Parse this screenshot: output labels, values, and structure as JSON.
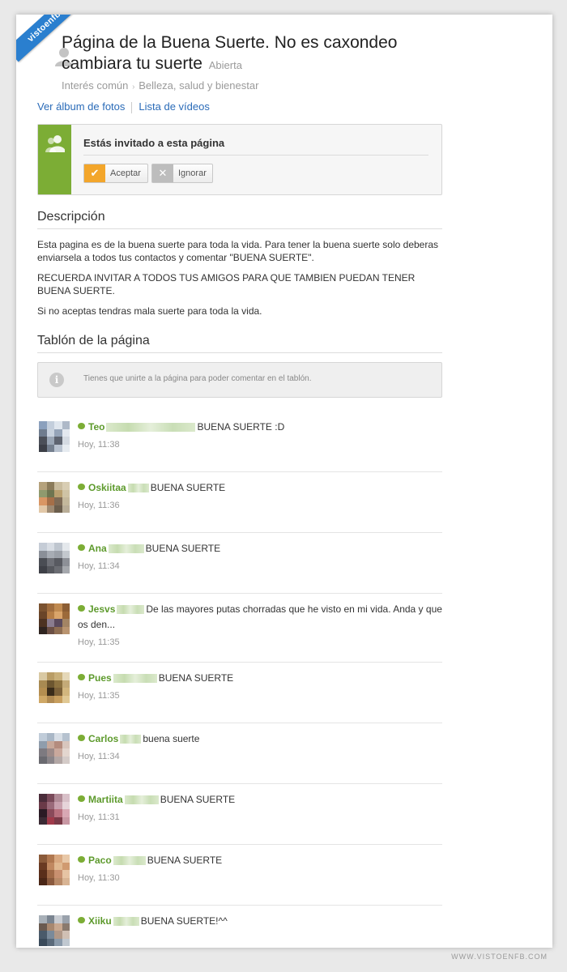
{
  "ribbon": "vistoenfb.com",
  "page": {
    "title": "Página de la Buena Suerte. No es caxondeo cambiara tu suerte",
    "status": "Abierta",
    "breadcrumb": [
      "Interés común",
      "Belleza, salud y bienestar"
    ]
  },
  "links": {
    "photos": "Ver álbum de fotos",
    "videos": "Lista de vídeos"
  },
  "invite": {
    "title": "Estás invitado a esta página",
    "accept_label": "Aceptar",
    "ignore_label": "Ignorar",
    "accent_color": "#7cad35"
  },
  "description": {
    "heading": "Descripción",
    "paragraphs": [
      "Esta pagina es de la buena suerte para toda la vida. Para tener la buena suerte solo deberas enviarsela a todos tus contactos y comentar \"BUENA SUERTE\".",
      "RECUERDA INVITAR A TODOS TUS AMIGOS PARA QUE TAMBIEN PUEDAN TENER BUENA SUERTE.",
      "Si no aceptas tendras mala suerte para toda la vida."
    ]
  },
  "wall": {
    "heading": "Tablón de la página",
    "notice": "Tienes que unirte a la página para poder comentar en el tablón.",
    "comments": [
      {
        "author": "Teo",
        "text": "BUENA SUERTE :D",
        "time": "Hoy, 11:38"
      },
      {
        "author": "Oskiitaa",
        "text": "BUENA SUERTE",
        "time": "Hoy, 11:36"
      },
      {
        "author": "Ana",
        "text": "BUENA SUERTE",
        "time": "Hoy, 11:34"
      },
      {
        "author": "Jesvs",
        "text": "De las mayores putas chorradas que he visto en mi vida. Anda y que os den...",
        "time": "Hoy, 11:35"
      },
      {
        "author": "Pues",
        "text": "BUENA SUERTE",
        "time": "Hoy, 11:35"
      },
      {
        "author": "Carlos",
        "text": "buena suerte",
        "time": "Hoy, 11:34"
      },
      {
        "author": "Martiita",
        "text": "BUENA SUERTE",
        "time": "Hoy, 11:31"
      },
      {
        "author": "Paco",
        "text": "BUENA SUERTE",
        "time": "Hoy, 11:30"
      },
      {
        "author": "Xiiku",
        "text": "BUENA SUERTE!^^",
        "time": ""
      }
    ]
  },
  "footer": "WWW.VISTOENFB.COM"
}
